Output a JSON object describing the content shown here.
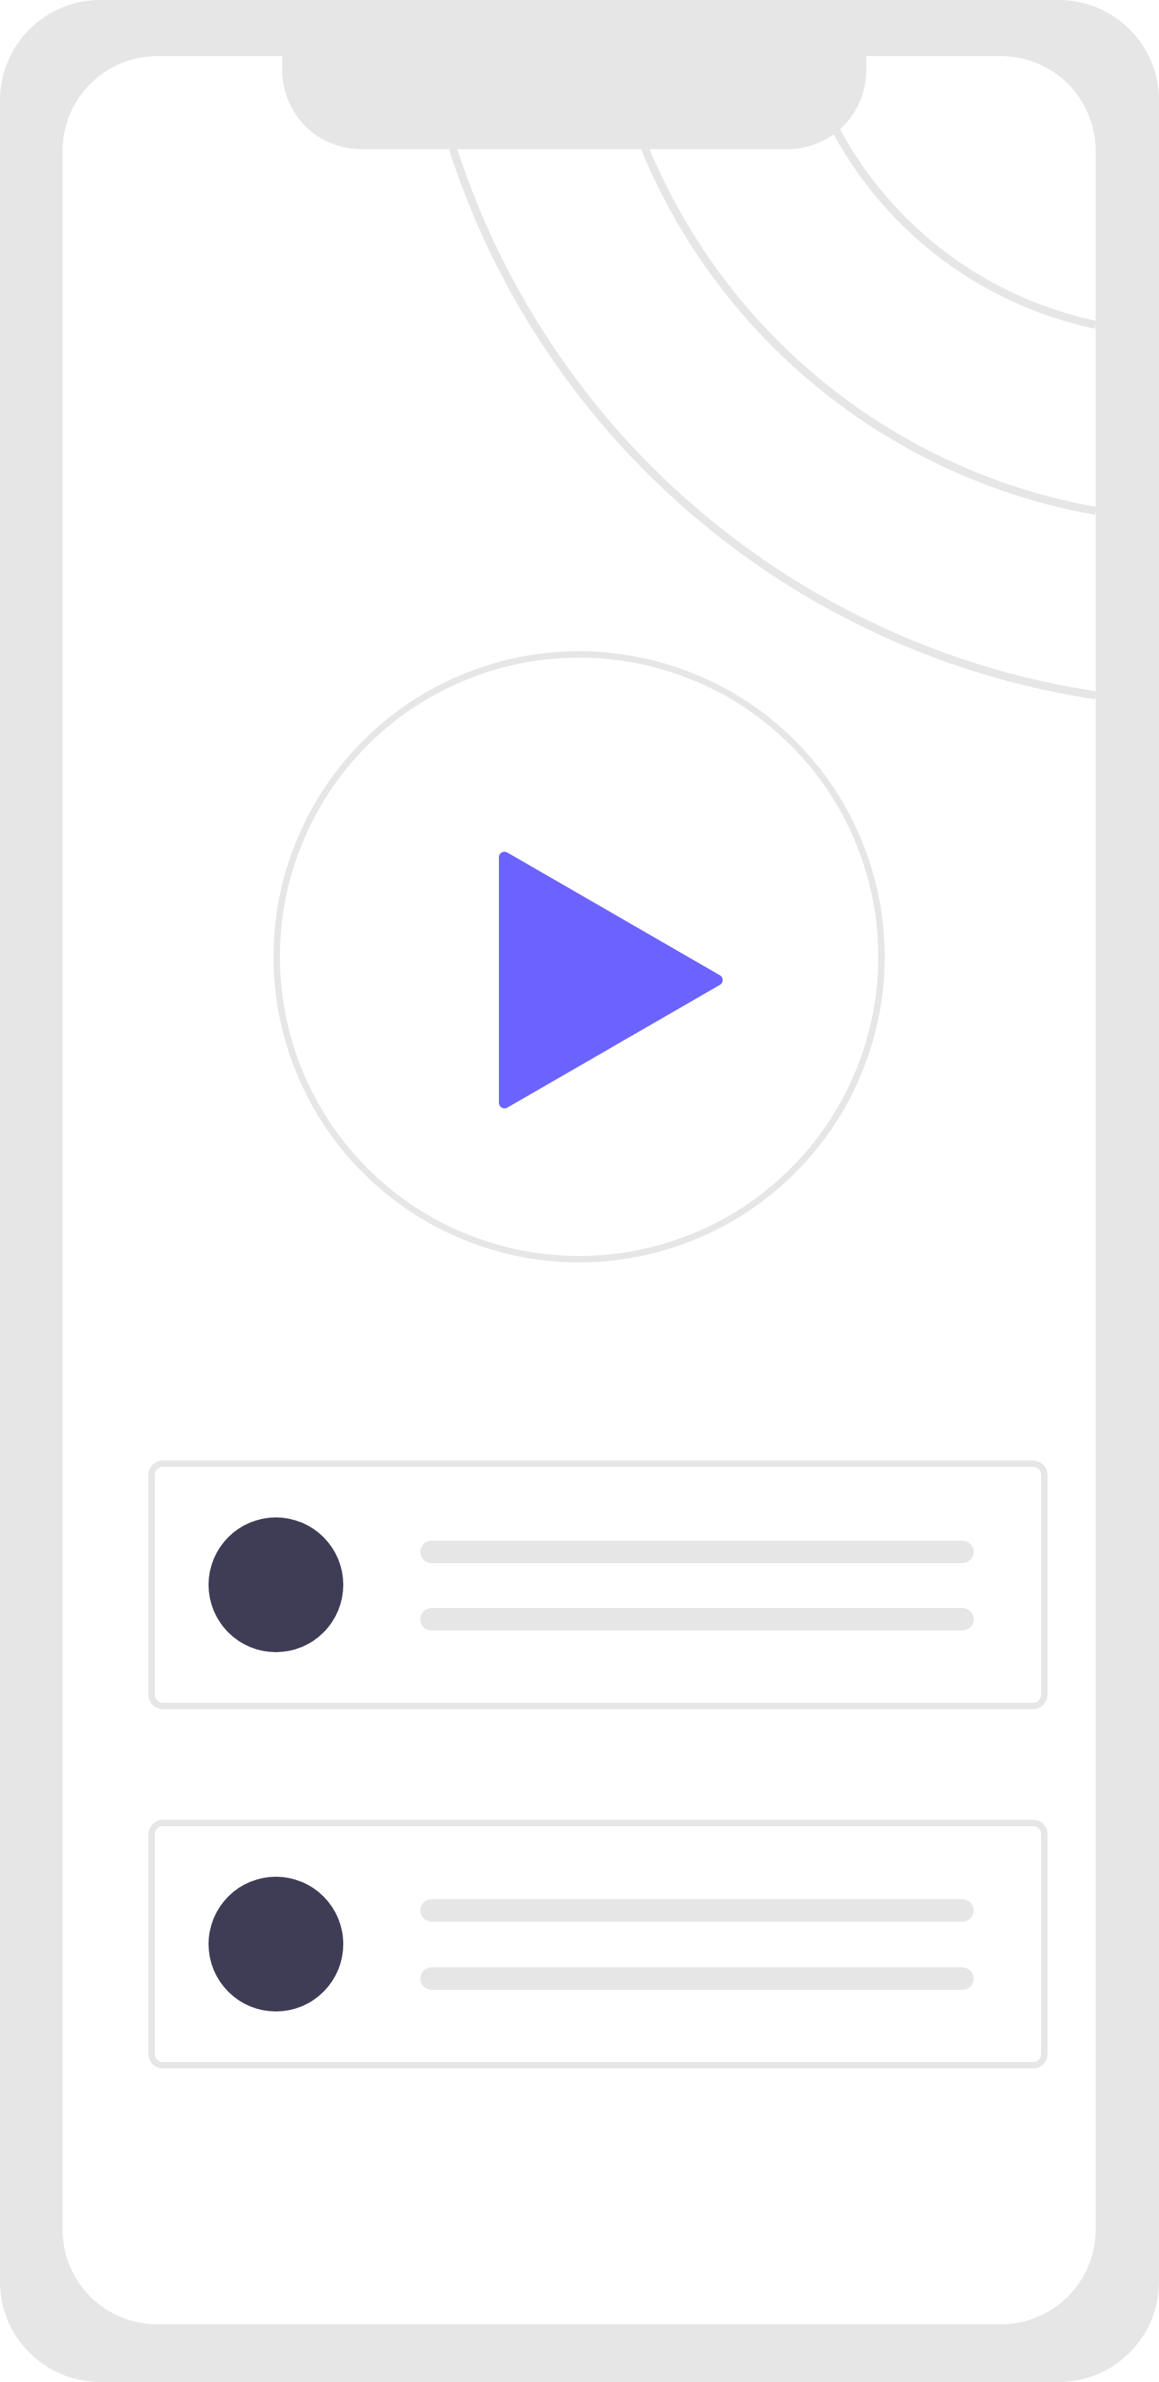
{
  "colors": {
    "frame": "#e6e6e6",
    "screen": "#ffffff",
    "accent": "#6c63ff",
    "avatar": "#3f3d56",
    "placeholder": "#e6e6e6"
  },
  "play_button": {
    "icon": "play-icon"
  },
  "list_items": [
    {
      "avatar": "user-avatar",
      "text_lines": 2
    },
    {
      "avatar": "user-avatar",
      "text_lines": 2
    }
  ]
}
